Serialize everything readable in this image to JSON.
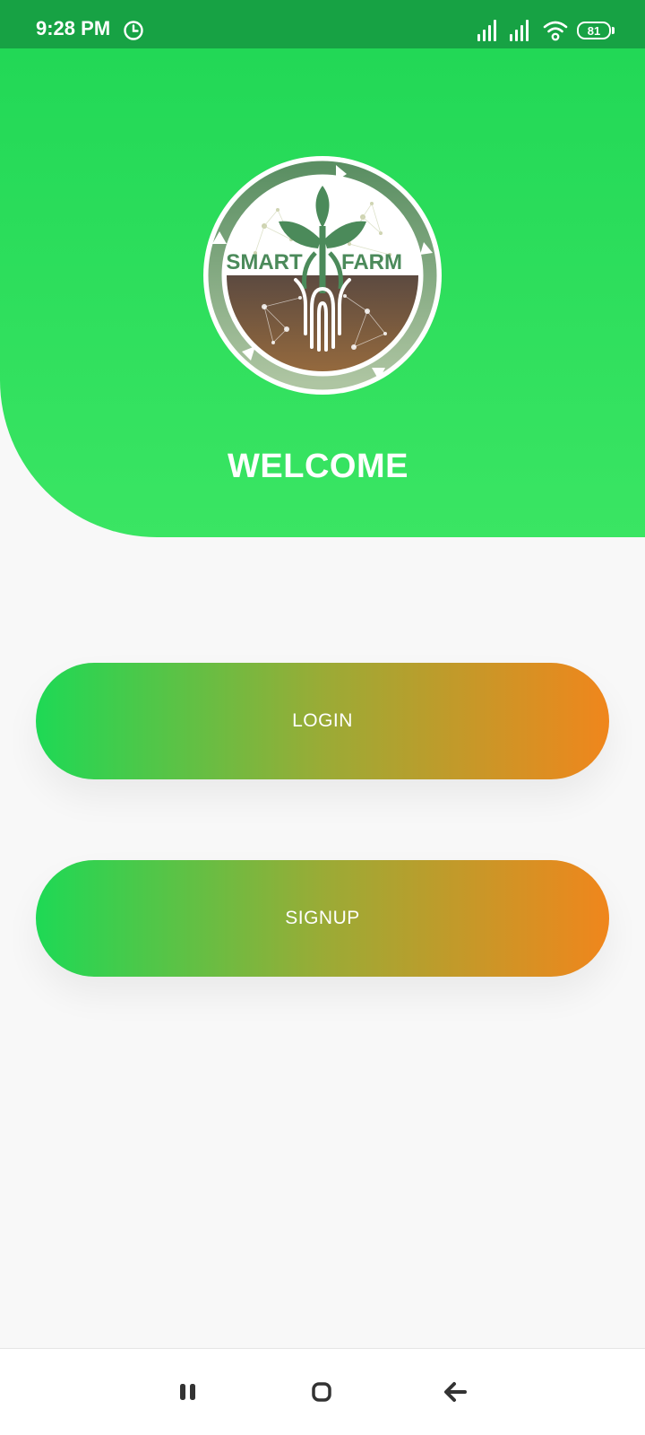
{
  "status_bar": {
    "time": "9:28 PM",
    "battery_level": "81",
    "icons": [
      "alarm-clock-icon",
      "signal-icon",
      "signal-icon",
      "wifi-icon",
      "battery-icon"
    ]
  },
  "header": {
    "logo": {
      "word_left": "SMART",
      "word_right": "FARM"
    },
    "title": "WELCOME"
  },
  "actions": {
    "login_label": "LOGIN",
    "signup_label": "SIGNUP"
  },
  "nav_bar": {
    "icons": [
      "recents-icon",
      "home-icon",
      "back-icon"
    ]
  },
  "colors": {
    "status_bar": "#17a244",
    "header_green": "#22d856",
    "button_start": "#1ed955",
    "button_end": "#f0861c",
    "background": "#f8f8f8",
    "logo_green": "#4b8a5a",
    "soil_brown": "#6b4f3e"
  }
}
